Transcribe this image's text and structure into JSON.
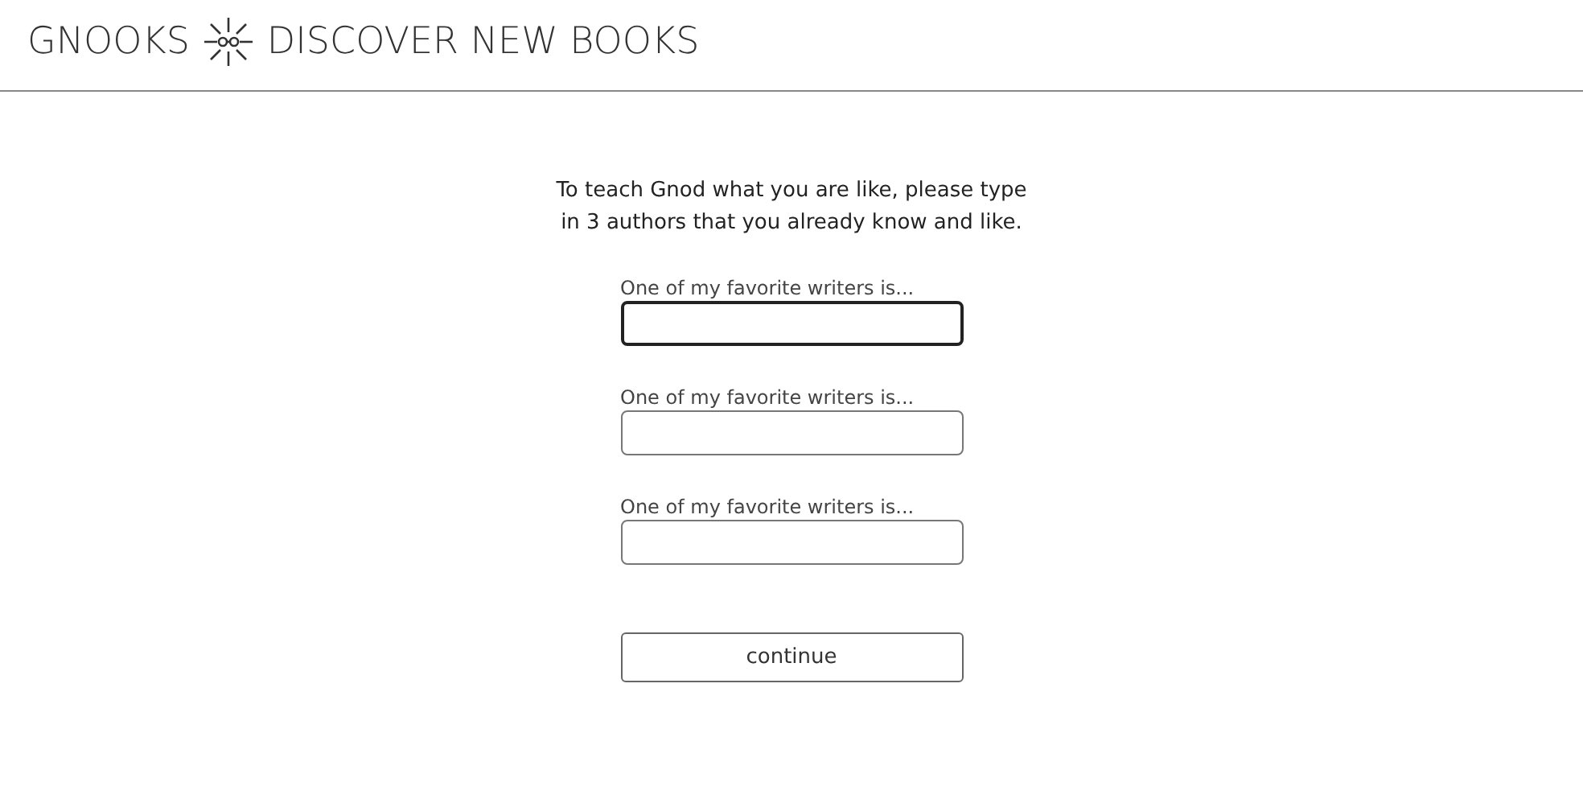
{
  "header": {
    "brand": "GNOOKS",
    "tagline": "DISCOVER NEW BOOKS"
  },
  "intro": "To teach Gnod what you are like, please type in 3 authors that you already know and like.",
  "fields": [
    {
      "label": "One of my favorite writers is...",
      "focused": true
    },
    {
      "label": "One of my favorite writers is...",
      "focused": false
    },
    {
      "label": "One of my favorite writers is...",
      "focused": false
    }
  ],
  "button": "continue"
}
